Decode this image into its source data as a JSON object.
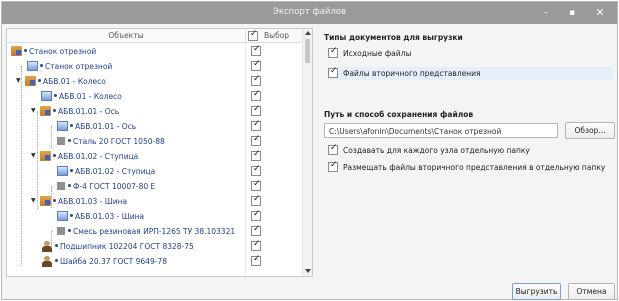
{
  "window": {
    "title": "Экспорт файлов",
    "minimize_glyph": "–",
    "maximize_glyph": "▪",
    "close_glyph": "✕"
  },
  "tree": {
    "col_objects": "Объекты",
    "col_choice": "Выбор",
    "rows": [
      {
        "label": "Станок отрезной",
        "icon": "assembly-icon",
        "checked": true
      },
      {
        "label": "Станок отрезной",
        "icon": "part-icon",
        "checked": true
      },
      {
        "label": "АБВ.01 - Колесо",
        "icon": "assembly-icon",
        "checked": true
      },
      {
        "label": "АБВ.01 - Колесо",
        "icon": "part-icon",
        "checked": true
      },
      {
        "label": "АБВ.01.01 - Ось",
        "icon": "assembly-icon",
        "checked": true
      },
      {
        "label": "АБВ.01.01 - Ось",
        "icon": "part-icon",
        "checked": true
      },
      {
        "label": "Сталь 20 ГОСТ 1050-88",
        "icon": "material-icon",
        "checked": true
      },
      {
        "label": "АБВ.01.02 - Ступица",
        "icon": "assembly-icon",
        "checked": true
      },
      {
        "label": "АБВ.01.02 - Ступица",
        "icon": "part-icon",
        "checked": true
      },
      {
        "label": "Ф-4 ГОСТ 10007-80 Е",
        "icon": "material-icon",
        "checked": true
      },
      {
        "label": "АБВ.01.03 - Шина",
        "icon": "assembly-icon",
        "checked": true
      },
      {
        "label": "АБВ.01.03 - Шина",
        "icon": "part-icon",
        "checked": true
      },
      {
        "label": "Смесь резиновая ИРП-1265 ТУ 38.103321",
        "icon": "material-icon",
        "checked": true
      },
      {
        "label": "Подшипник 102204 ГОСТ 8328-75",
        "icon": "standard-part-icon",
        "checked": true
      },
      {
        "label": "Шайба 20.37 ГОСТ 9649-78",
        "icon": "standard-part-icon",
        "checked": true
      }
    ]
  },
  "doc_types": {
    "title": "Типы документов для выгрузки",
    "source_files": {
      "label": "Исходные файлы",
      "checked": true
    },
    "secondary_files": {
      "label": "Файлы вторичного представления",
      "checked": true
    }
  },
  "save": {
    "title": "Путь и способ сохранения файлов",
    "path": "C:\\Users\\afonin\\Documents\\Станок отрезной",
    "browse_label": "Обзор...",
    "separate_folder": {
      "label": "Создавать для каждого узла отдельную папку",
      "checked": true
    },
    "secondary_separate": {
      "label": "Размещать файлы вторичного представления в отдельную папку",
      "checked": true
    }
  },
  "footer": {
    "export_label": "Выгрузить",
    "cancel_label": "Отмена"
  }
}
